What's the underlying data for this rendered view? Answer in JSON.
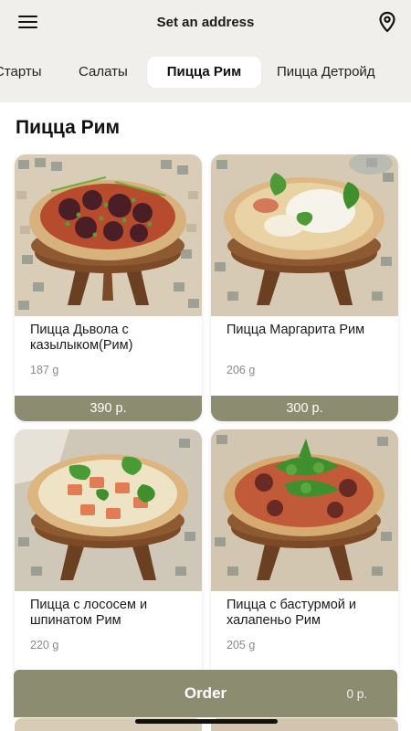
{
  "header": {
    "title": "Set an address",
    "menu_icon": "hamburger-menu-icon",
    "location_icon": "map-pin-icon"
  },
  "tabs": [
    {
      "label": "Старты",
      "active": false
    },
    {
      "label": "Салаты",
      "active": false
    },
    {
      "label": "Пицца Рим",
      "active": true
    },
    {
      "label": "Пицца Детройд",
      "active": false
    }
  ],
  "section": {
    "title": "Пицца Рим"
  },
  "products": [
    {
      "name": "Пицца Дьвола  с казылыком(Рим)",
      "weight": "187 g",
      "price": "390 р."
    },
    {
      "name": "Пицца Маргарита Рим",
      "weight": "206 g",
      "price": "300 р."
    },
    {
      "name": "Пицца с  лососем и шпинатом Рим",
      "weight": "220 g",
      "price": ""
    },
    {
      "name": "Пицца с бастурмой и халапеньо Рим",
      "weight": "205 g",
      "price": ""
    }
  ],
  "order": {
    "label": "Order",
    "total": "0 р."
  },
  "colors": {
    "accent": "#8c8c70",
    "top_background": "#f0efeb",
    "page_background": "#ffffff"
  }
}
